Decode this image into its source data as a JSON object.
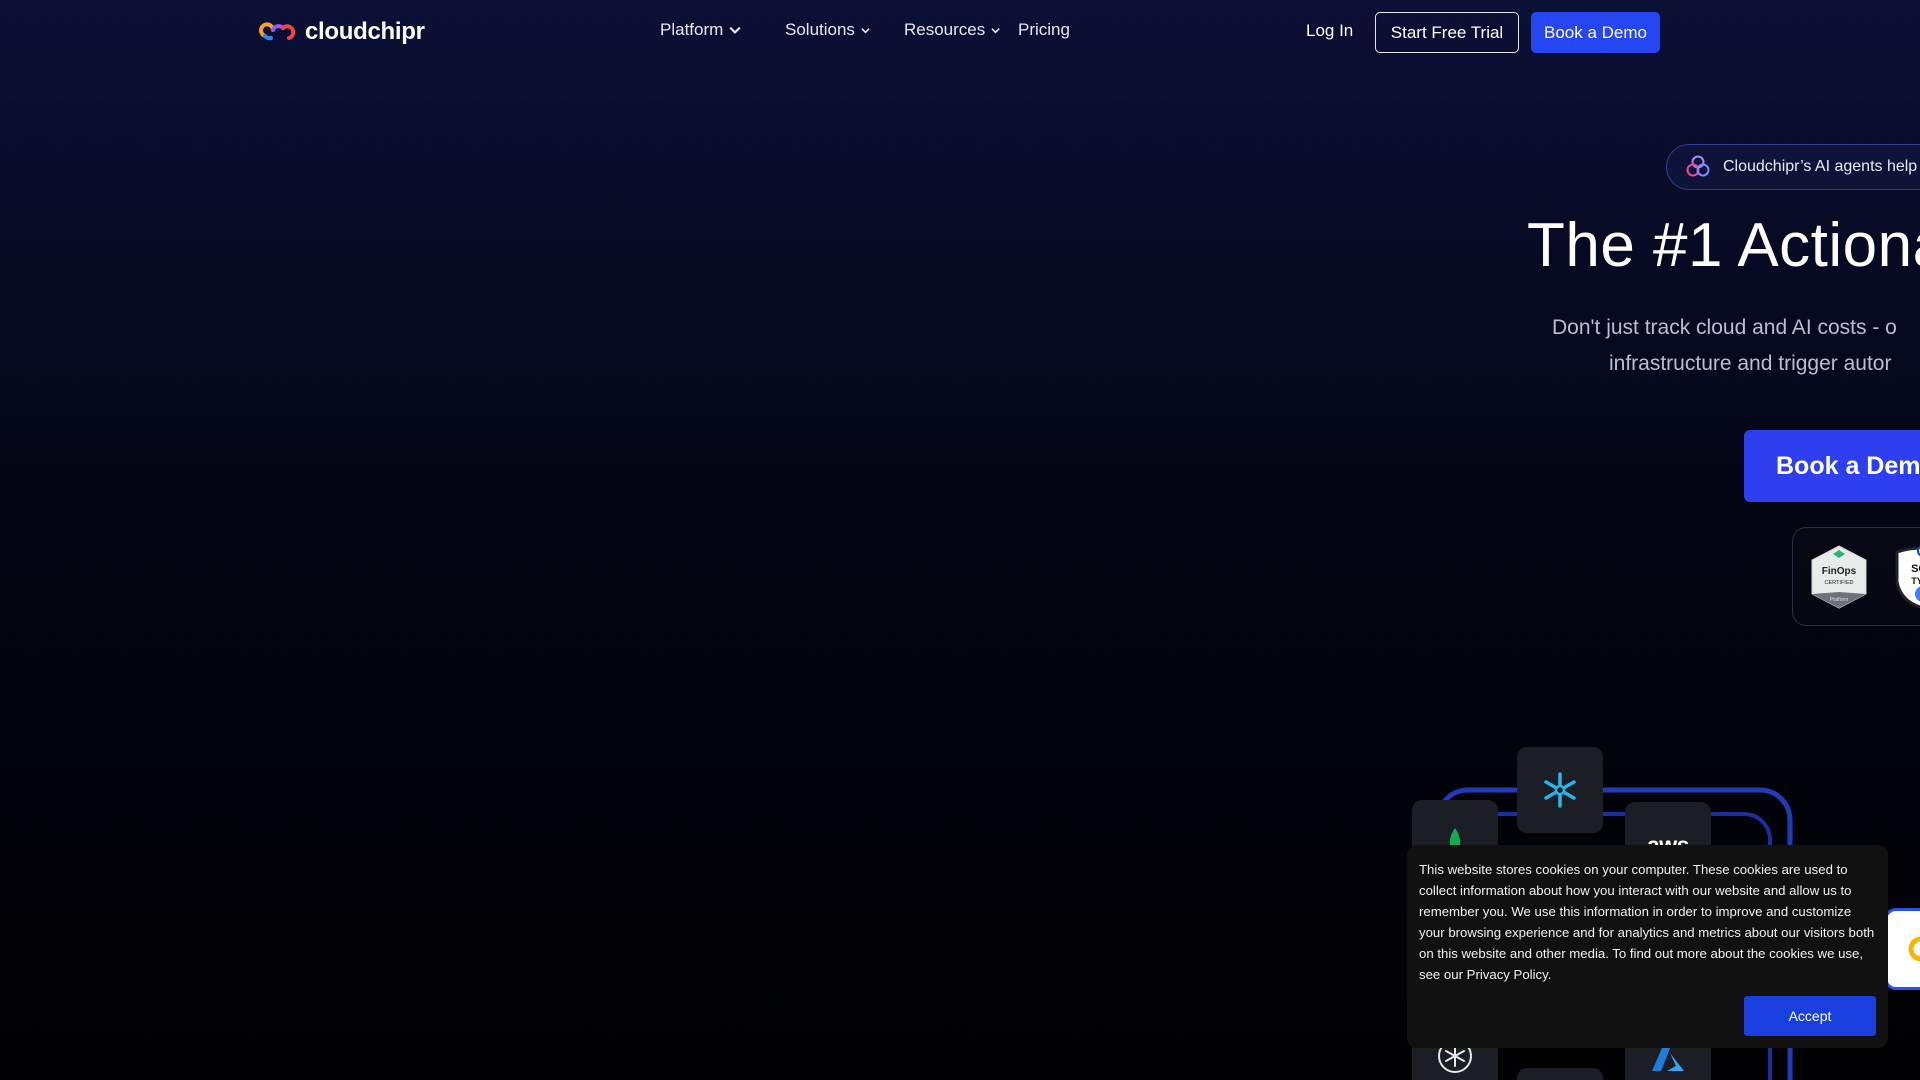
{
  "brand": {
    "name": "cloudchipr",
    "logo_icon": "cloudchipr-logo-icon"
  },
  "nav": {
    "items": [
      {
        "label": "Platform",
        "has_dropdown": true
      },
      {
        "label": "Solutions",
        "has_dropdown": true
      },
      {
        "label": "Resources",
        "has_dropdown": true
      },
      {
        "label": "Pricing",
        "has_dropdown": false
      }
    ],
    "login": "Log In",
    "trial": "Start Free Trial",
    "demo": "Book a Demo"
  },
  "hero": {
    "badge_text": "Cloudchipr’s AI agents help y",
    "badge_icon": "ai-agents-icon",
    "title": "The #1 Actiona",
    "subtitle_line1": "Don't just track cloud and AI costs - o",
    "subtitle_line2": "infrastructure and trigger autor",
    "cta": "Book a Dem"
  },
  "certifications": {
    "finops": {
      "line1": "FinOps",
      "line2": "CERTIFIED",
      "line3": "Platform"
    },
    "soc": {
      "line1": "SOC",
      "line2": "TYPE"
    }
  },
  "integrations": {
    "tiles": [
      {
        "name": "snowflake",
        "icon": "snowflake-icon"
      },
      {
        "name": "mongodb",
        "icon": "mongodb-leaf-icon"
      },
      {
        "name": "aws",
        "label": "aws"
      },
      {
        "name": "openai",
        "icon": "openai-icon"
      },
      {
        "name": "azure",
        "icon": "azure-icon"
      }
    ]
  },
  "cookie": {
    "text": "This website stores cookies on your computer. These cookies are used to collect information about how you interact with our website and allow us to remember you. We use this information in order to improve and customize your browsing experience and for analytics and metrics about our visitors both on this website and other media. To find out more about the cookies we use, see our Privacy Policy.",
    "accept": "Accept"
  },
  "colors": {
    "accent": "#2546f0",
    "background_top": "#0b1036",
    "background_bottom": "#010103",
    "ring": "#2a4df5"
  }
}
